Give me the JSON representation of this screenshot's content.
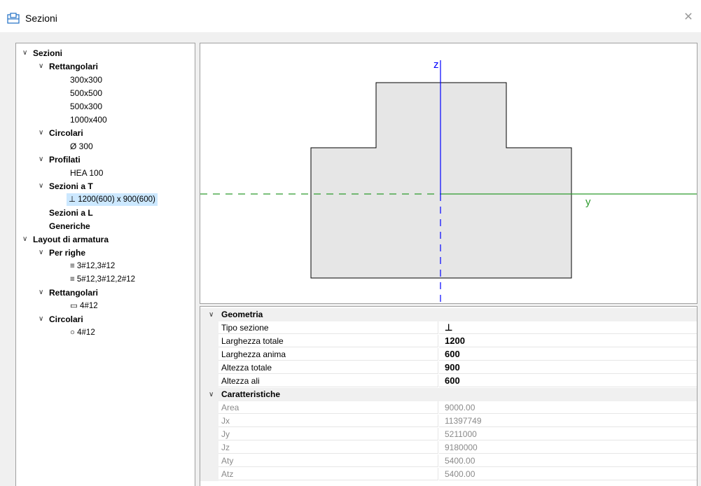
{
  "window": {
    "title": "Sezioni",
    "close_glyph": "✕",
    "icon": "window-icon"
  },
  "tree": {
    "chevron": "∨",
    "sezioni": "Sezioni",
    "rettangolari": "Rettangolari",
    "r1": "300x300",
    "r2": "500x500",
    "r3": "500x300",
    "r4": "1000x400",
    "circolari": "Circolari",
    "c1": "Ø 300",
    "profilati": "Profilati",
    "p1": "HEA 100",
    "sezioni_t": "Sezioni a T",
    "t1": "⊥ 1200(600) x 900(600)",
    "sezioni_l": "Sezioni a L",
    "generiche": "Generiche",
    "layout": "Layout di armatura",
    "per_righe": "Per righe",
    "pr1": "≡ 3#12,3#12",
    "pr2": "≡ 5#12,3#12,2#12",
    "l_rettangolari": "Rettangolari",
    "lr1": "▭ 4#12",
    "l_circolari": "Circolari",
    "lc1": "○ 4#12"
  },
  "canvas": {
    "z_label": "z",
    "y_label": "y"
  },
  "properties": {
    "geometria": "Geometria",
    "caratteristiche": "Caratteristiche",
    "geom_rows": [
      {
        "name": "Tipo sezione",
        "value": "⊥"
      },
      {
        "name": "Larghezza totale",
        "value": "1200"
      },
      {
        "name": "Larghezza anima",
        "value": "600"
      },
      {
        "name": "Altezza totale",
        "value": "900"
      },
      {
        "name": "Altezza ali",
        "value": "600"
      }
    ],
    "car_rows": [
      {
        "name": "Area",
        "value": "9000.00"
      },
      {
        "name": "Jx",
        "value": "11397749"
      },
      {
        "name": "Jy",
        "value": "5211000"
      },
      {
        "name": "Jz",
        "value": "9180000"
      },
      {
        "name": "Aty",
        "value": "5400.00"
      },
      {
        "name": "Atz",
        "value": "5400.00"
      }
    ]
  },
  "colors": {
    "axis_z": "#0000ff",
    "axis_y": "#2e9b2e",
    "section_fill": "#e6e6e6",
    "selection": "#cce8ff"
  }
}
